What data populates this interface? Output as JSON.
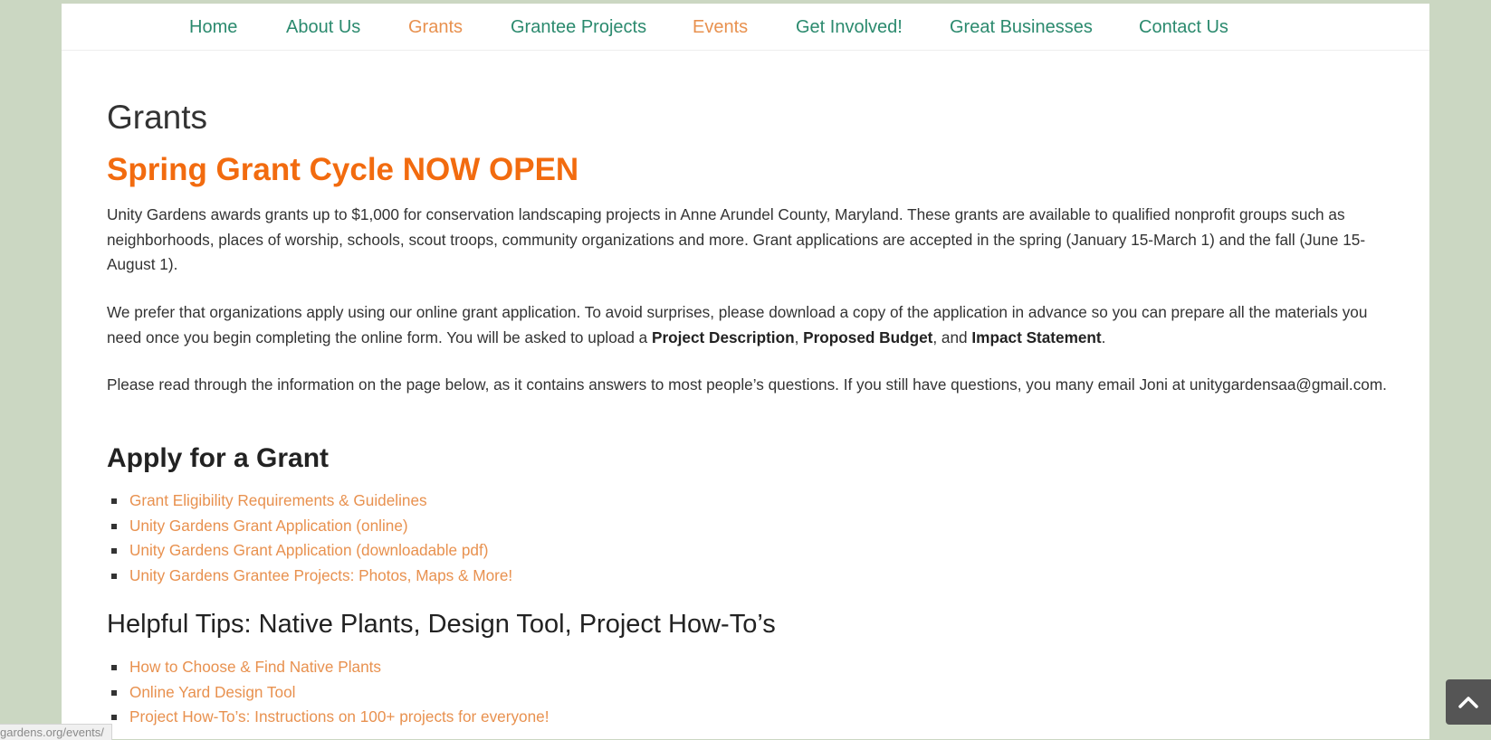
{
  "nav": {
    "items": [
      {
        "label": "Home",
        "color": "#2b8a6e"
      },
      {
        "label": "About Us",
        "color": "#2b8a6e"
      },
      {
        "label": "Grants",
        "color": "#e8914f"
      },
      {
        "label": "Grantee Projects",
        "color": "#2b8a6e"
      },
      {
        "label": "Events",
        "color": "#e8914f"
      },
      {
        "label": "Get Involved!",
        "color": "#2b8a6e"
      },
      {
        "label": "Great Businesses",
        "color": "#2b8a6e"
      },
      {
        "label": "Contact Us",
        "color": "#2b8a6e"
      }
    ]
  },
  "main": {
    "page_title": "Grants",
    "cycle_title": "Spring Grant Cycle NOW OPEN",
    "intro": "Unity Gardens awards grants up to $1,000 for conservation landscaping projects in Anne Arundel County, Maryland. These grants are available to qualified nonprofit groups such as neighborhoods, places of worship, schools, scout troops, community organizations and more.  Grant applications are accepted in the spring (January 15-March 1) and the fall (June 15-August 1).",
    "prefer": {
      "text_before": "We prefer that organizations apply using our online grant application. To avoid surprises, please download a copy of the application in advance so you can prepare all the materials you need once you begin completing the online form. You will be asked to upload a ",
      "bold1": "Project Description",
      "sep1": ", ",
      "bold2": "Proposed Budget",
      "sep2": ", and ",
      "bold3": "Impact Statement",
      "end": "."
    },
    "read_through": "Please read through the information on the page below, as it contains answers to most people’s questions. If you still have questions, you many email Joni at unitygardensaa@gmail.com.",
    "apply_heading": "Apply for a Grant",
    "apply_links": [
      "Grant Eligibility Requirements & Guidelines",
      "Unity Gardens Grant Application (online)",
      "Unity Gardens Grant Application (downloadable pdf)",
      "Unity Gardens Grantee Projects: Photos, Maps & More!"
    ],
    "tips_heading": "Helpful Tips: Native Plants, Design Tool, Project How-To’s",
    "tips_links": [
      "How to Choose & Find Native Plants",
      "Online Yard Design Tool",
      "Project How-To’s: Instructions on 100+ projects for everyone!"
    ]
  },
  "status_bar": {
    "url_visible": "gardens.org/events/"
  },
  "colors": {
    "background": "#cbd7c2",
    "accent_orange": "#f26b0f",
    "link_orange": "#e8914f",
    "nav_green": "#2b8a6e"
  },
  "icons": {
    "scroll_top": "chevron-up-icon"
  }
}
